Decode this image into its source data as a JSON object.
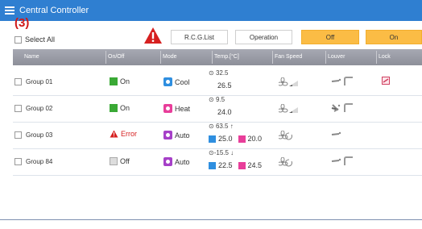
{
  "app": {
    "title": "Central Controller"
  },
  "annotation": {
    "step": "(3)"
  },
  "toolbar": {
    "select_all": "Select All",
    "rcg_list": "R.C.G.List",
    "operation": "Operation",
    "off": "Off",
    "on": "On"
  },
  "table": {
    "headers": [
      "Name",
      "On/Off",
      "Mode",
      "Temp.[°C]",
      "Fan Speed",
      "Louver",
      "Lock"
    ],
    "rows": [
      {
        "name": "Group 01",
        "status": "On",
        "mode": "Cool",
        "temp_room": "32.5",
        "temp_set": "26.5",
        "temp_cool": "",
        "temp_heat": "",
        "locked": true
      },
      {
        "name": "Group 02",
        "status": "On",
        "mode": "Heat",
        "temp_room": "9.5",
        "temp_set": "24.0",
        "temp_cool": "",
        "temp_heat": "",
        "locked": false
      },
      {
        "name": "Group 03",
        "status": "Error",
        "mode": "Auto",
        "temp_room": "63.5",
        "temp_set": "",
        "temp_cool": "25.0",
        "temp_heat": "20.0",
        "locked": false
      },
      {
        "name": "Group 84",
        "status": "Off",
        "mode": "Auto",
        "temp_room": "-15.5",
        "temp_set": "",
        "temp_cool": "22.5",
        "temp_heat": "24.5",
        "locked": false
      }
    ]
  },
  "colors": {
    "titlebar": "#2f7fd1",
    "on_green": "#3aa935",
    "cool_blue": "#2f8fe0",
    "heat_pink": "#e83e9a",
    "auto_purple": "#a640c8",
    "error_red": "#d62020",
    "orange_button": "#fbbc45"
  }
}
